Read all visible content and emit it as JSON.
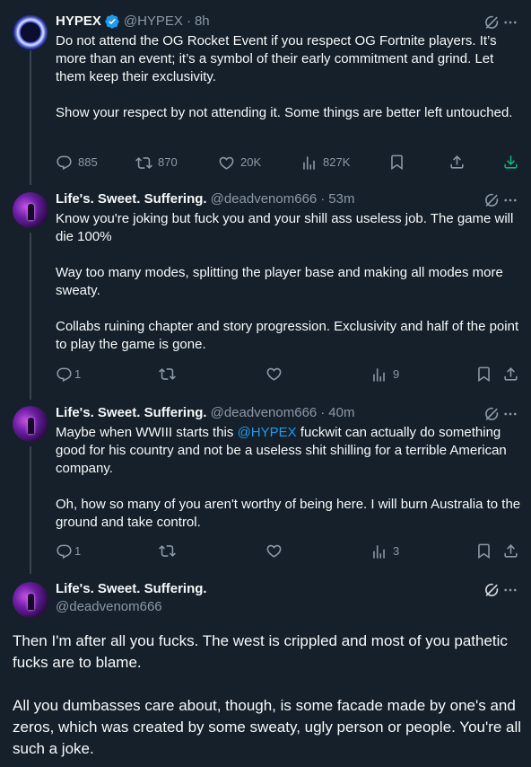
{
  "posts": [
    {
      "name": "HYPEX",
      "handle": "@HYPEX",
      "time": "8h",
      "text": "Do not attend the OG Rocket Event if you respect OG Fortnite players. It’s more than an event; it’s a symbol of their early commitment and grind. Let them keep their exclusivity.\n\nShow your respect by not attending it. Some things are better left untouched.",
      "replies": "885",
      "reposts": "870",
      "likes": "20K",
      "views": "827K"
    },
    {
      "name": "Life's. Sweet. Suffering.",
      "handle": "@deadvenom666",
      "time": "53m",
      "text": "Know you're joking but fuck you and your shill ass useless job. The game will die 100%\n\nWay too many modes, splitting the player base and making all modes more sweaty.\n\nCollabs ruining chapter and story progression. Exclusivity and half of the point to play the game is gone.",
      "replies": "1",
      "views": "9"
    },
    {
      "name": "Life's. Sweet. Suffering.",
      "handle": "@deadvenom666",
      "time": "40m",
      "text_before": "Maybe when WWIII starts this ",
      "mention": "@HYPEX",
      "text_after": " fuckwit can actually do something good for his country and not be a useless shit shilling for a terrible American company.\n\nOh, how so many of you aren't worthy of being here. I will burn Australia to the ground and take control.",
      "replies": "1",
      "views": "3"
    },
    {
      "name": "Life's. Sweet. Suffering.",
      "handle": "@deadvenom666",
      "text": "Then I'm after all you fucks. The west is crippled and most of you pathetic fucks are to blame.\n\nAll you dumbasses care about, though, is some facade made by one's and zeros, which was created by some sweaty, ugly person or people. You're all such a joke."
    }
  ],
  "colors": {
    "background": "#15202b",
    "text": "#f7f9f9",
    "muted": "#8b98a5",
    "accent": "#1d9bf0",
    "download": "#00ba7c"
  },
  "icons": [
    "verified-badge-icon",
    "grok-icon",
    "more-icon",
    "reply-icon",
    "repost-icon",
    "like-icon",
    "views-icon",
    "bookmark-icon",
    "share-icon",
    "download-icon"
  ]
}
